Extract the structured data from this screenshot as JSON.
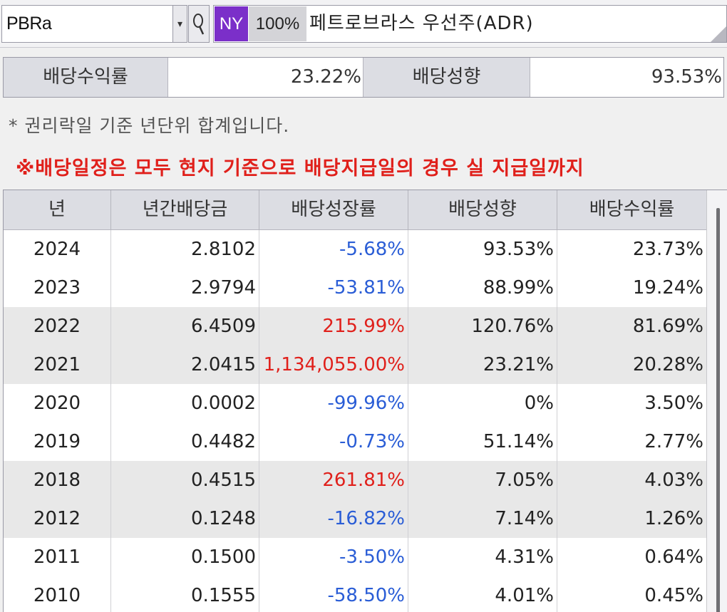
{
  "header": {
    "ticker": "PBRa",
    "dropdown_symbol": "▾",
    "exchange": "NY",
    "percent": "100%",
    "stock_name": "페트로브라스 우선주(ADR)"
  },
  "summary": {
    "yield_label": "배당수익률",
    "yield_value": "23.22%",
    "payout_label": "배당성향",
    "payout_value": "93.53%"
  },
  "note": "* 권리락일 기준 년단위 합계입니다.",
  "warning": "※배당일정은 모두 현지 기준으로 배당지급일의 경우 실 지급일까지",
  "table": {
    "headers": [
      "년",
      "년간배당금",
      "배당성장률",
      "배당성향",
      "배당수익률"
    ],
    "rows": [
      {
        "year": "2024",
        "dividend": "2.8102",
        "growth": "-5.68%",
        "payout": "93.53%",
        "yield": "23.73%"
      },
      {
        "year": "2023",
        "dividend": "2.9794",
        "growth": "-53.81%",
        "payout": "88.99%",
        "yield": "19.24%"
      },
      {
        "year": "2022",
        "dividend": "6.4509",
        "growth": "215.99%",
        "payout": "120.76%",
        "yield": "81.69%"
      },
      {
        "year": "2021",
        "dividend": "2.0415",
        "growth": "1,134,055.00%",
        "payout": "23.21%",
        "yield": "20.28%"
      },
      {
        "year": "2020",
        "dividend": "0.0002",
        "growth": "-99.96%",
        "payout": "0%",
        "yield": "3.50%"
      },
      {
        "year": "2019",
        "dividend": "0.4482",
        "growth": "-0.73%",
        "payout": "51.14%",
        "yield": "2.77%"
      },
      {
        "year": "2018",
        "dividend": "0.4515",
        "growth": "261.81%",
        "payout": "7.05%",
        "yield": "4.03%"
      },
      {
        "year": "2012",
        "dividend": "0.1248",
        "growth": "-16.82%",
        "payout": "7.14%",
        "yield": "1.26%"
      },
      {
        "year": "2011",
        "dividend": "0.1500",
        "growth": "-3.50%",
        "payout": "4.31%",
        "yield": "0.64%"
      },
      {
        "year": "2010",
        "dividend": "0.1555",
        "growth": "-58.50%",
        "payout": "4.01%",
        "yield": "0.45%"
      }
    ]
  },
  "colors": {
    "exchange_badge": "#7b2fc9",
    "negative": "#2a5dd6",
    "positive": "#e0201b",
    "warning": "#e0201b"
  },
  "icons": {
    "search": "search-icon",
    "dropdown": "chevron-down-icon"
  }
}
